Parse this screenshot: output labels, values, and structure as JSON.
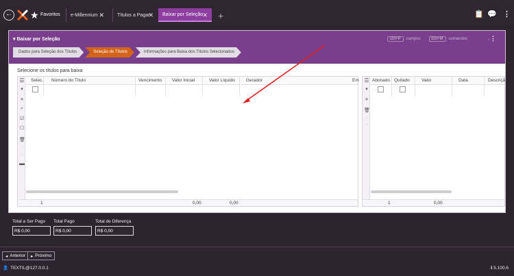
{
  "topbar": {
    "favorites_label": "Favoritos",
    "tabs": [
      {
        "label": "e-Millennium"
      },
      {
        "label": "Títulos a Pagar"
      },
      {
        "label": "Baixar por Seleção"
      }
    ]
  },
  "panel": {
    "title": "Baixar por Seleção",
    "shortcut_fields_key": "ctrl+P",
    "shortcut_fields_label": "campos",
    "shortcut_commands_key": "ctrl+M",
    "shortcut_commands_label": "comandos",
    "separator": "|",
    "steps": [
      {
        "label": "Dados para Seleção dos Títulos"
      },
      {
        "label": "Seleção de Títulos"
      },
      {
        "label": "Informações para Baixa dos Títulos Selecionados"
      }
    ],
    "section_label": "Selecione os títulos para baixa"
  },
  "left_grid": {
    "columns": [
      "Selec.",
      "Número do Título",
      "Vencimento",
      "Valor Inicial",
      "Valor Líquido",
      "Gerador",
      "Em"
    ],
    "footer": {
      "count": "1",
      "valor_inicial": "0,00",
      "valor_liquido": "0,00"
    }
  },
  "right_grid": {
    "columns": [
      "Abonado",
      "Quitado",
      "Valor",
      "Data",
      "Descriçã"
    ],
    "footer": {
      "count": "1",
      "valor": "0,00"
    }
  },
  "totals": {
    "total_ser_pago_label": "Total a Ser Pago",
    "total_ser_pago_value": "R$ 0,00",
    "total_pago_label": "Total Pago",
    "total_pago_value": "R$ 0,00",
    "total_diferenca_label": "Total de Diferença",
    "total_diferenca_value": "R$ 0,00"
  },
  "nav": {
    "prev_label": "Anterior",
    "next_label": "Próximo"
  },
  "status": {
    "user_host": "TEXTIL@127.0.0.1",
    "version": "5.100.6"
  },
  "colors": {
    "header_purple": "#7a3f8c",
    "active_step": "#d4631a",
    "active_tab": "#8e3da0",
    "annotation_arrow": "#e02020"
  }
}
